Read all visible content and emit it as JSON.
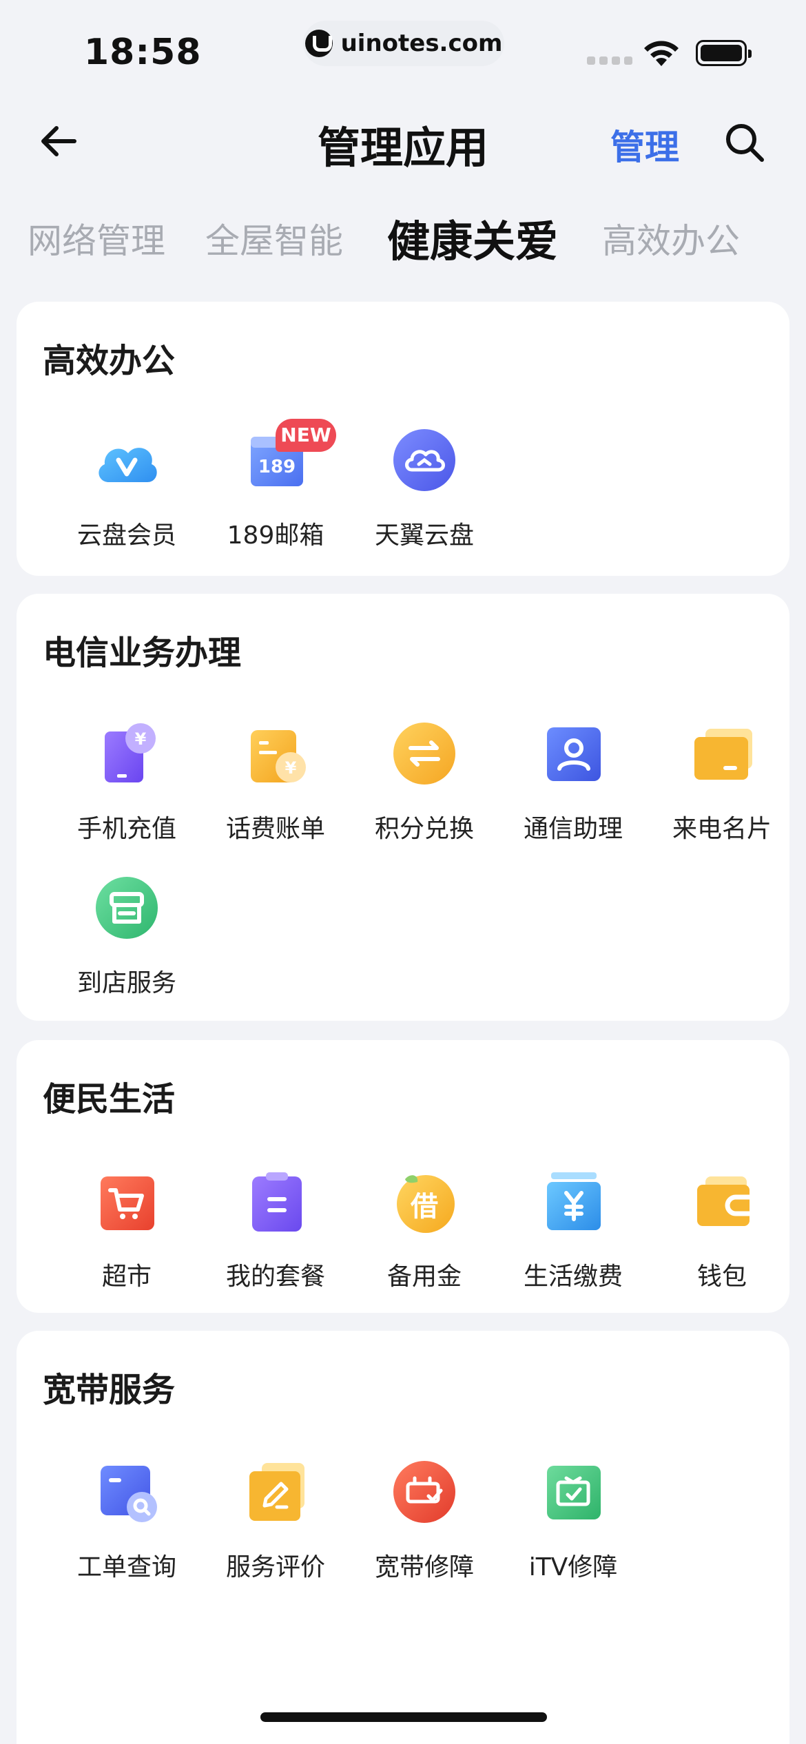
{
  "status_bar": {
    "time": "18:58",
    "url": "uinotes.com"
  },
  "nav": {
    "title": "管理应用",
    "manage_label": "管理"
  },
  "tabs": [
    {
      "label": "网络管理"
    },
    {
      "label": "全屋智能"
    },
    {
      "label": "健康关爱",
      "active": true
    },
    {
      "label": "高效办公"
    }
  ],
  "sections": {
    "office": {
      "title": "高效办公",
      "items": [
        {
          "label": "云盘会员",
          "icon": "cloud-vip-icon"
        },
        {
          "label": "189邮箱",
          "icon": "mail-189-icon",
          "badge": "NEW"
        },
        {
          "label": "天翼云盘",
          "icon": "cloud-disk-icon"
        }
      ]
    },
    "telecom": {
      "title": "电信业务办理",
      "items": [
        {
          "label": "手机充值",
          "icon": "phone-recharge-icon"
        },
        {
          "label": "话费账单",
          "icon": "bill-icon"
        },
        {
          "label": "积分兑换",
          "icon": "points-exchange-icon"
        },
        {
          "label": "通信助理",
          "icon": "comm-assistant-icon"
        },
        {
          "label": "来电名片",
          "icon": "caller-card-icon"
        },
        {
          "label": "到店服务",
          "icon": "store-service-icon"
        }
      ]
    },
    "life": {
      "title": "便民生活",
      "items": [
        {
          "label": "超市",
          "icon": "supermarket-icon"
        },
        {
          "label": "我的套餐",
          "icon": "my-plan-icon"
        },
        {
          "label": "备用金",
          "icon": "loan-icon",
          "glyph": "借"
        },
        {
          "label": "生活缴费",
          "icon": "utility-payment-icon"
        },
        {
          "label": "钱包",
          "icon": "wallet-icon"
        }
      ]
    },
    "broadband": {
      "title": "宽带服务",
      "items": [
        {
          "label": "工单查询",
          "icon": "ticket-query-icon"
        },
        {
          "label": "服务评价",
          "icon": "service-review-icon"
        },
        {
          "label": "宽带修障",
          "icon": "broadband-repair-icon"
        },
        {
          "label": "iTV修障",
          "icon": "itv-repair-icon"
        }
      ]
    }
  },
  "colors": {
    "accent": "#3c6fe8",
    "badge": "#ee4a55",
    "background": "#f2f3f7"
  }
}
